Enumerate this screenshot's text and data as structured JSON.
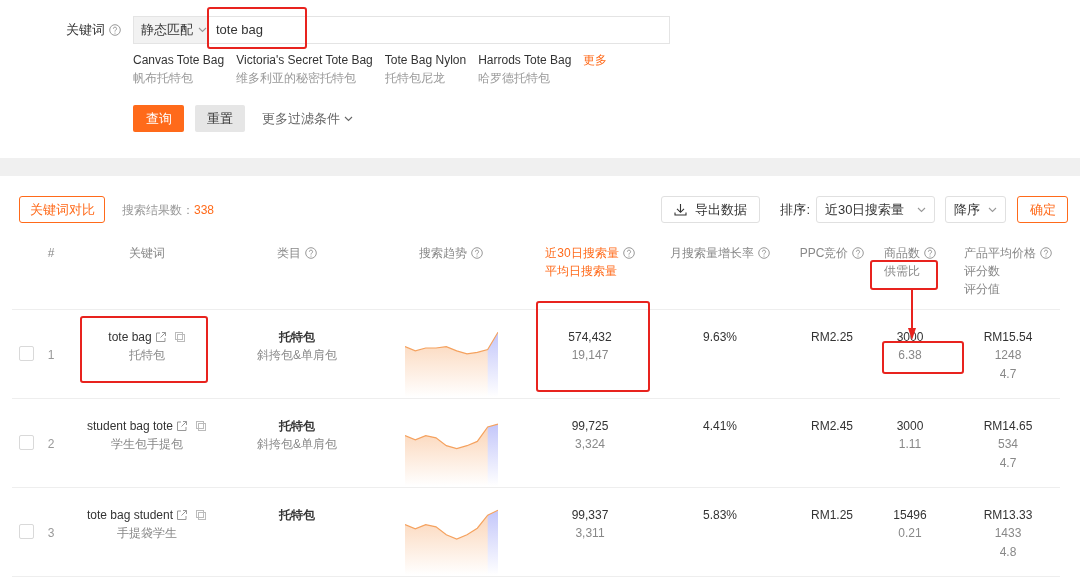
{
  "search": {
    "label": "关键词",
    "match_mode": "静态匹配",
    "value": "tote bag",
    "highlighted": true
  },
  "suggestions": [
    {
      "en": "Canvas Tote Bag",
      "zh": "帆布托特包"
    },
    {
      "en": "Victoria's Secret Tote Bag",
      "zh": "维多利亚的秘密托特包"
    },
    {
      "en": "Tote Bag Nylon",
      "zh": "托特包尼龙"
    },
    {
      "en": "Harrods Tote Bag",
      "zh": "哈罗德托特包"
    }
  ],
  "more_link": "更多",
  "actions": {
    "query": "查询",
    "reset": "重置",
    "more_filters": "更多过滤条件"
  },
  "toolbar": {
    "compare": "关键词对比",
    "result_label": "搜索结果数：",
    "result_count": "338",
    "export": "导出数据",
    "sort_label": "排序:",
    "sort_field": "近30日搜索量",
    "sort_order": "降序",
    "confirm": "确定"
  },
  "columns": [
    {
      "lines": [
        {
          "text": "#",
          "highlighted": false
        }
      ],
      "help": false,
      "sorted": false
    },
    {
      "lines": [
        {
          "text": "关键词",
          "highlighted": false
        }
      ],
      "help": false,
      "sorted": false
    },
    {
      "lines": [
        {
          "text": "类目",
          "highlighted": false
        }
      ],
      "help": true,
      "sorted": false
    },
    {
      "lines": [
        {
          "text": "搜索趋势",
          "highlighted": false
        }
      ],
      "help": true,
      "sorted": false
    },
    {
      "lines": [
        {
          "text": "近30日搜索量",
          "highlighted": false
        },
        {
          "text": "平均日搜索量",
          "highlighted": false
        }
      ],
      "help": true,
      "sorted": true
    },
    {
      "lines": [
        {
          "text": "月搜索量增长率",
          "highlighted": false
        }
      ],
      "help": true,
      "sorted": false
    },
    {
      "lines": [
        {
          "text": "PPC竞价",
          "highlighted": false
        }
      ],
      "help": true,
      "sorted": false
    },
    {
      "lines": [
        {
          "text": "商品数",
          "highlighted": false
        },
        {
          "text": "供需比",
          "highlighted": true,
          "arrow_to_first_row": true
        }
      ],
      "help": true,
      "sorted": false
    },
    {
      "lines": [
        {
          "text": "产品平均价格",
          "highlighted": false
        },
        {
          "text": "评分数",
          "highlighted": false
        },
        {
          "text": "评分值",
          "highlighted": false
        }
      ],
      "help": true,
      "sorted": false
    }
  ],
  "rows": [
    {
      "checked": false,
      "index": "1",
      "keyword": "tote bag",
      "translation": "托特包",
      "keyword_highlighted": true,
      "category": "托特包",
      "subcategory": "斜挎包&单肩包",
      "volume": "574,432",
      "daily": "19,147",
      "volume_highlighted": true,
      "growth": "9.63%",
      "ppc": "RM2.25",
      "products": "3000",
      "ratio": "6.38",
      "ratio_highlighted": true,
      "price": "RM15.54",
      "ratings": "1248",
      "score": "4.7"
    },
    {
      "checked": false,
      "index": "2",
      "keyword": "student bag tote",
      "translation": "学生包手提包",
      "keyword_highlighted": false,
      "category": "托特包",
      "subcategory": "斜挎包&单肩包",
      "volume": "99,725",
      "daily": "3,324",
      "volume_highlighted": false,
      "growth": "4.41%",
      "ppc": "RM2.45",
      "products": "3000",
      "ratio": "1.11",
      "ratio_highlighted": false,
      "price": "RM14.65",
      "ratings": "534",
      "score": "4.7"
    },
    {
      "checked": false,
      "index": "3",
      "keyword": "tote bag student",
      "translation": "手提袋学生",
      "keyword_highlighted": false,
      "category": "托特包",
      "volume": "99,337",
      "daily": "3,311",
      "volume_highlighted": false,
      "growth": "5.83%",
      "ppc": "RM1.25",
      "products": "15496",
      "ratio": "0.21",
      "ratio_highlighted": false,
      "price": "RM13.33",
      "ratings": "1433",
      "score": "4.8"
    }
  ]
}
